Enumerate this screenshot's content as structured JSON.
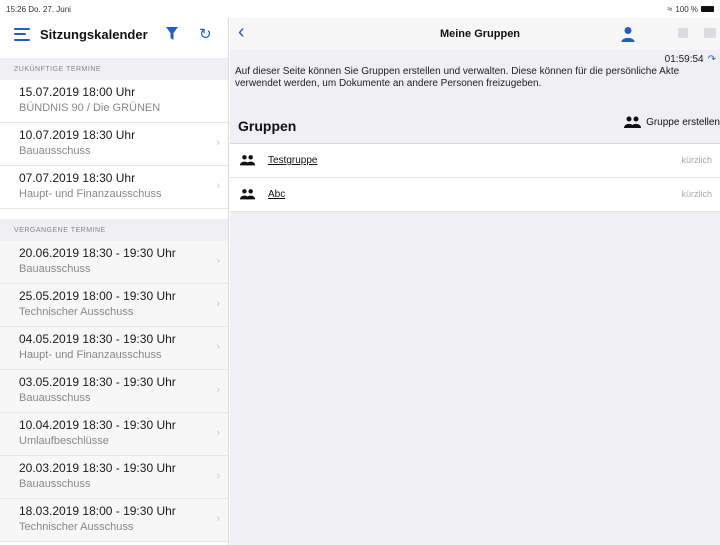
{
  "status": {
    "time": "15:26",
    "date": "Do. 27. Juni",
    "battery": "100 %"
  },
  "sidebar": {
    "title": "Sitzungskalender",
    "sections": [
      {
        "label": "ZUKÜNFTIGE TERMINE",
        "items": [
          {
            "date": "15.07.2019 18:00 Uhr",
            "sub": "BÜNDNIS 90 / Die GRÜNEN"
          },
          {
            "date": "10.07.2019 18:30 Uhr",
            "sub": "Bauausschuss"
          },
          {
            "date": "07.07.2019 18:30 Uhr",
            "sub": "Haupt- und Finanzausschuss"
          }
        ]
      },
      {
        "label": "VERGANGENE TERMINE",
        "items": [
          {
            "date": "20.06.2019 18:30 - 19:30 Uhr",
            "sub": "Bauausschuss"
          },
          {
            "date": "25.05.2019 18:00 - 19:30 Uhr",
            "sub": "Technischer Ausschuss"
          },
          {
            "date": "04.05.2019 18:30 - 19:30 Uhr",
            "sub": "Haupt- und Finanzausschuss"
          },
          {
            "date": "03.05.2019 18:30 - 19:30 Uhr",
            "sub": "Bauausschuss"
          },
          {
            "date": "10.04.2019 18:30 - 19:30 Uhr",
            "sub": "Umlaufbeschlüsse"
          },
          {
            "date": "20.03.2019 18:30 - 19:30 Uhr",
            "sub": "Bauausschuss"
          },
          {
            "date": "18.03.2019 18:00 - 19:30 Uhr",
            "sub": "Technischer Ausschuss"
          }
        ]
      }
    ]
  },
  "main": {
    "title": "Meine Gruppen",
    "clock": "01:59:54",
    "info": "Auf dieser Seite können Sie Gruppen erstellen und verwalten. Diese können für die persönliche Akte verwendet werden, um Dokumente an andere Personen freizugeben.",
    "groups_title": "Gruppen",
    "create_label": "Gruppe erstellen",
    "groups": [
      {
        "name": "Testgruppe",
        "when": "kürzlich"
      },
      {
        "name": "Abc",
        "when": "kürzlich"
      }
    ]
  },
  "colors": {
    "accent": "#1e5fc8",
    "background": "#efeff4"
  },
  "icons": {
    "menu": "menu-icon",
    "filter": "filter-icon",
    "refresh": "refresh-icon",
    "back": "chevron-left-icon",
    "user": "user-icon",
    "group": "group-icon"
  }
}
